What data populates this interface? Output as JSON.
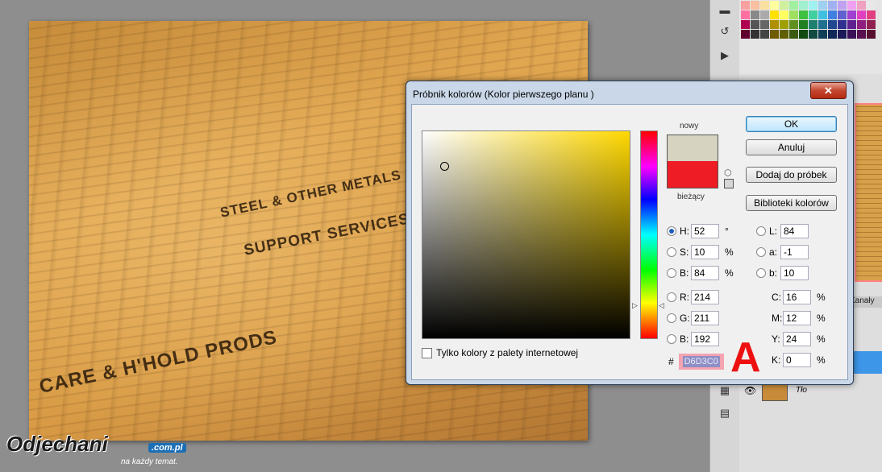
{
  "canvas": {
    "headlines": [
      "STEEL & OTHER METALS",
      "SUPPORT SERVICES",
      "CARE & H'HOLD PRODS"
    ],
    "watermark": {
      "logo": "Odjechani",
      "domain": ".com.pl",
      "tagline": "na każdy temat."
    }
  },
  "layers_panel": {
    "channels_tab": "Kanały",
    "layer_name": "Tło"
  },
  "dialog": {
    "title": "Próbnik kolorów (Kolor pierwszego planu )",
    "close": "✕",
    "new_label": "nowy",
    "current_label": "bieżący",
    "new_color": "#d6d3c0",
    "current_color": "#ee1c25",
    "buttons": {
      "ok": "OK",
      "cancel": "Anuluj",
      "add_swatch": "Dodaj do próbek",
      "libraries": "Biblioteki kolorów"
    },
    "web_only": "Tylko kolory z palety internetowej",
    "hsb": [
      {
        "label": "H:",
        "value": "52",
        "unit": "°"
      },
      {
        "label": "S:",
        "value": "10",
        "unit": "%"
      },
      {
        "label": "B:",
        "value": "84",
        "unit": "%"
      }
    ],
    "lab": [
      {
        "label": "L:",
        "value": "84"
      },
      {
        "label": "a:",
        "value": "-1"
      },
      {
        "label": "b:",
        "value": "10"
      }
    ],
    "rgb": [
      {
        "label": "R:",
        "value": "214"
      },
      {
        "label": "G:",
        "value": "211"
      },
      {
        "label": "B:",
        "value": "192"
      }
    ],
    "cmyk": [
      {
        "label": "C:",
        "value": "16",
        "unit": "%"
      },
      {
        "label": "M:",
        "value": "12",
        "unit": "%"
      },
      {
        "label": "Y:",
        "value": "24",
        "unit": "%"
      },
      {
        "label": "K:",
        "value": "0",
        "unit": "%"
      }
    ],
    "hex_hash": "#",
    "hex": "D6D3C0"
  },
  "annotation": "A"
}
